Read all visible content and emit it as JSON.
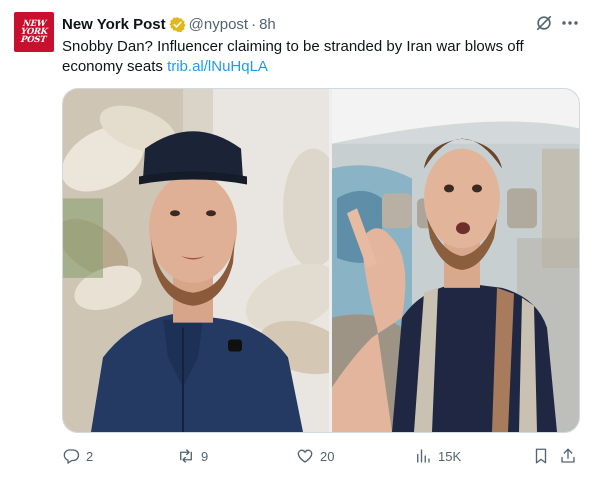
{
  "tweet": {
    "author_name": "New York Post",
    "handle": "@nypost",
    "separator": "·",
    "time": "8h",
    "avatar_text": [
      "NEW",
      "YORK",
      "POST"
    ],
    "text": "Snobby Dan? Influencer claiming to be stranded by Iran war blows off economy seats ",
    "link": "trib.al/lNuHqLA",
    "verified_badge_color": "#e2b719"
  },
  "actions": {
    "replies": "2",
    "reposts": "9",
    "likes": "20",
    "views": "15K"
  },
  "colors": {
    "link": "#1d9bf0",
    "secondary_text": "#536471",
    "brand_red": "#c8102e"
  },
  "icons": [
    "verified-icon",
    "grok-icon",
    "more-icon",
    "reply-icon",
    "repost-icon",
    "like-icon",
    "views-icon",
    "bookmark-icon",
    "share-icon"
  ]
}
